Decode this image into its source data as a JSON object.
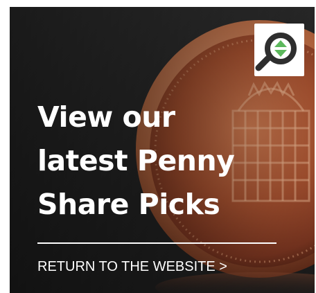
{
  "headline": {
    "line1": "View our",
    "line2": "latest Penny",
    "line3": "Share Picks"
  },
  "cta": {
    "label": "RETURN TO THE WEBSITE >"
  },
  "background": {
    "icon": "penny-coin-photo"
  },
  "logo": {
    "icon": "magnifier-up-down-arrows-icon",
    "colors": {
      "badge": "#ffffff",
      "ring": "#2e2e2e",
      "arrows": "#5cb85c"
    }
  }
}
